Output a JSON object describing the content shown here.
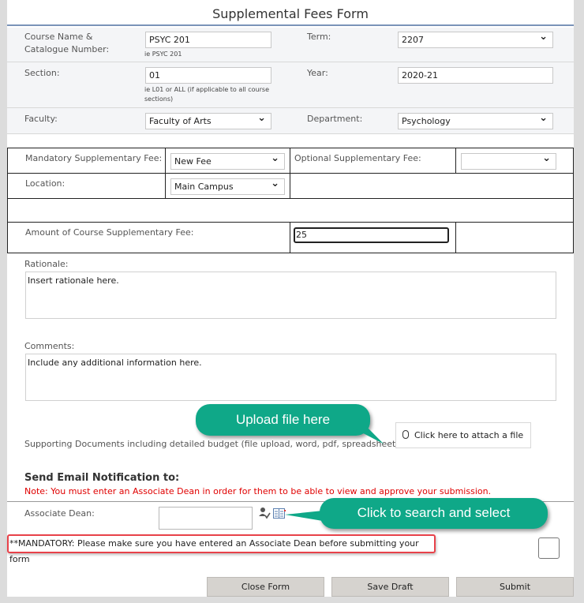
{
  "form": {
    "title": "Supplemental Fees Form"
  },
  "info": {
    "course_label_line1": "Course Name &",
    "course_label_line2": "Catalogue Number:",
    "course_value": "PSYC 201",
    "course_hint": "ie PSYC 201",
    "term_label": "Term:",
    "term_value": "2207",
    "section_label": "Section:",
    "section_value": "01",
    "section_hint_line1": "ie L01 or ALL (if applicable to all course",
    "section_hint_line2": "sections)",
    "year_label": "Year:",
    "year_value": "2020-21",
    "faculty_label": "Faculty:",
    "faculty_value": "Faculty of Arts",
    "department_label": "Department:",
    "department_value": "Psychology"
  },
  "fees": {
    "mandatory_label": "Mandatory Supplementary Fee:",
    "mandatory_value": "New Fee",
    "optional_label": "Optional Supplementary Fee:",
    "optional_value": "",
    "location_label": "Location:",
    "location_value": "Main Campus",
    "amount_label": "Amount of Course Supplementary Fee:",
    "amount_value": "25"
  },
  "rationale": {
    "label": "Rationale:",
    "value": "Insert rationale here."
  },
  "comments": {
    "label": "Comments:",
    "value": "Include any additional information here."
  },
  "supporting": {
    "label": "Supporting Documents including detailed budget (file upload, word, pdf, spreadsheet):",
    "attach_label": "Click here to attach a file",
    "attach_icon": "paperclip-icon"
  },
  "callouts": {
    "upload": "Upload file here",
    "search": "Click to search and select"
  },
  "notification": {
    "heading": "Send Email Notification to:",
    "note": "Note: You must enter an Associate Dean in order for them to be able to view and approve your submission.",
    "dean_label": "Associate Dean:",
    "dean_value": "",
    "check_names_icon": "check-names-icon",
    "browse_icon": "address-book-icon",
    "mandatory_text": "**MANDATORY: Please make sure you have entered an Associate Dean before submitting your form"
  },
  "actions": {
    "close": "Close Form",
    "save_draft": "Save Draft",
    "submit": "Submit"
  },
  "colors": {
    "callout": "#0fa888",
    "note_red": "#e00000",
    "highlight_border": "#e8424a",
    "title_rule": "#7a93b8"
  }
}
